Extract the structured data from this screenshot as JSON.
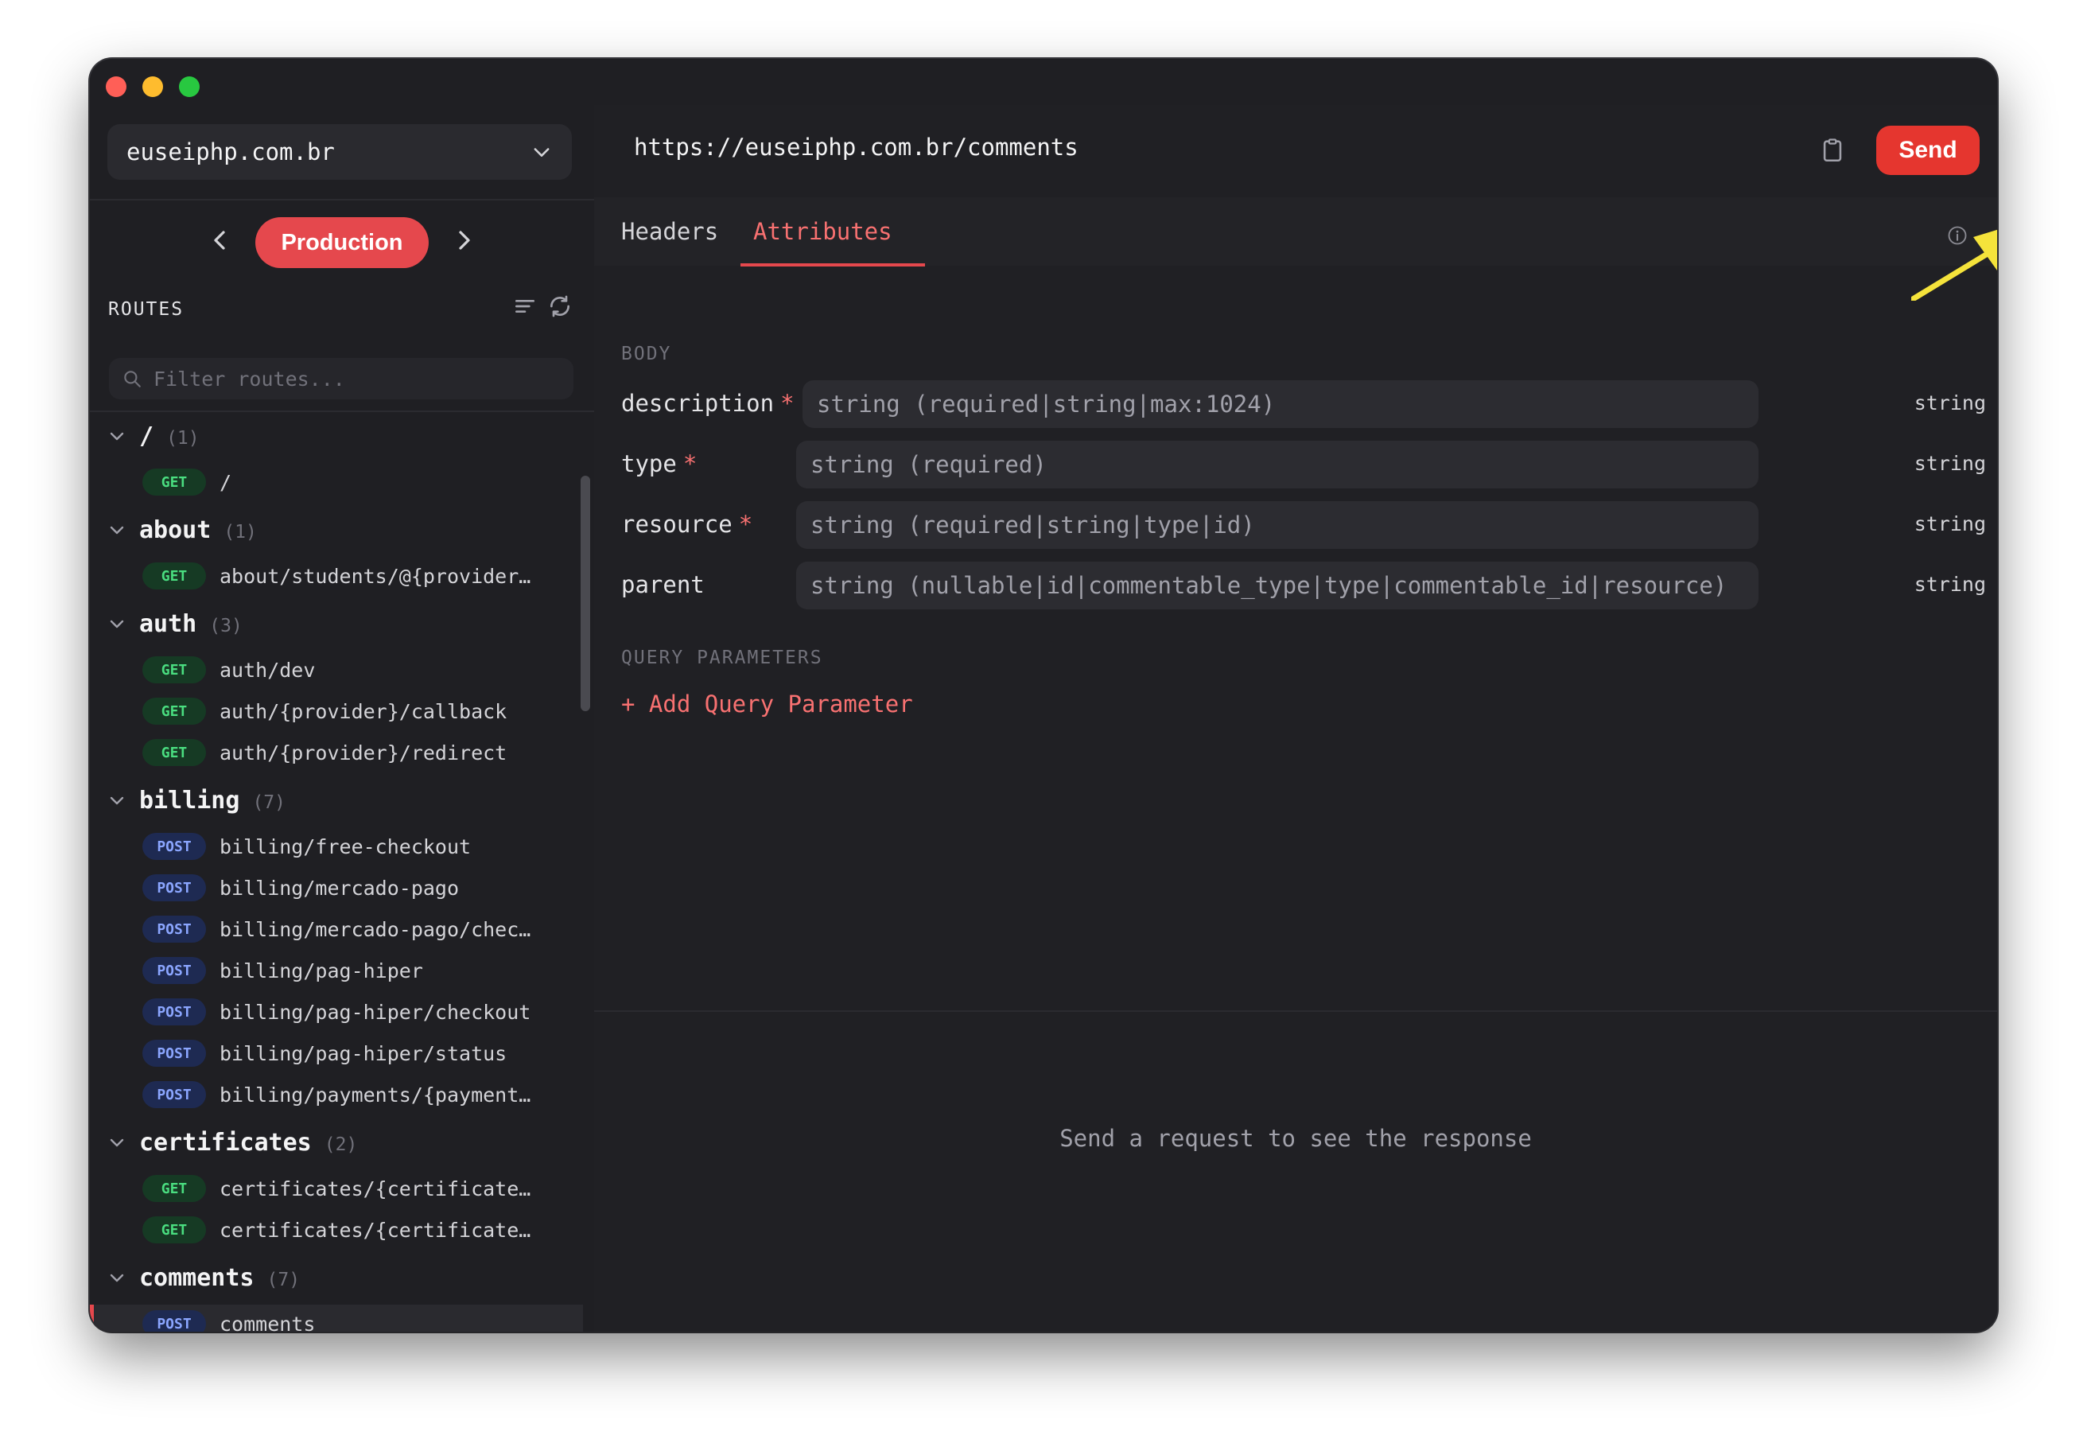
{
  "window": {
    "traffic_lights": [
      "close",
      "minimize",
      "zoom"
    ]
  },
  "sidebar": {
    "domain": "euseiphp.com.br",
    "environment": "Production",
    "routes_title": "ROUTES",
    "filter_placeholder": "Filter routes...",
    "groups": [
      {
        "name": "/",
        "count": "(1)",
        "routes": [
          {
            "method": "GET",
            "path": "/"
          }
        ]
      },
      {
        "name": "about",
        "count": "(1)",
        "routes": [
          {
            "method": "GET",
            "path": "about/students/@{provider…"
          }
        ]
      },
      {
        "name": "auth",
        "count": "(3)",
        "routes": [
          {
            "method": "GET",
            "path": "auth/dev"
          },
          {
            "method": "GET",
            "path": "auth/{provider}/callback"
          },
          {
            "method": "GET",
            "path": "auth/{provider}/redirect"
          }
        ]
      },
      {
        "name": "billing",
        "count": "(7)",
        "routes": [
          {
            "method": "POST",
            "path": "billing/free-checkout"
          },
          {
            "method": "POST",
            "path": "billing/mercado-pago"
          },
          {
            "method": "POST",
            "path": "billing/mercado-pago/chec…"
          },
          {
            "method": "POST",
            "path": "billing/pag-hiper"
          },
          {
            "method": "POST",
            "path": "billing/pag-hiper/checkout"
          },
          {
            "method": "POST",
            "path": "billing/pag-hiper/status"
          },
          {
            "method": "POST",
            "path": "billing/payments/{payment…"
          }
        ]
      },
      {
        "name": "certificates",
        "count": "(2)",
        "routes": [
          {
            "method": "GET",
            "path": "certificates/{certificate…"
          },
          {
            "method": "GET",
            "path": "certificates/{certificate…"
          }
        ]
      },
      {
        "name": "comments",
        "count": "(7)",
        "routes": [
          {
            "method": "POST",
            "path": "comments"
          }
        ]
      }
    ]
  },
  "request": {
    "url": "https://euseiphp.com.br/comments",
    "send_label": "Send",
    "tabs": {
      "headers": "Headers",
      "attributes": "Attributes"
    },
    "body_label": "BODY",
    "fields": [
      {
        "name": "description",
        "required": "*",
        "placeholder": "string (required|string|max:1024)",
        "type": "string"
      },
      {
        "name": "type",
        "required": "*",
        "placeholder": "string (required)",
        "type": "string"
      },
      {
        "name": "resource",
        "required": "*",
        "placeholder": "string (required|string|type|id)",
        "type": "string"
      },
      {
        "name": "parent",
        "required": "",
        "placeholder": "string (nullable|id|commentable_type|type|commentable_id|resource)",
        "type": "string"
      }
    ],
    "query_label": "QUERY PARAMETERS",
    "add_query": "+ Add Query Parameter"
  },
  "response": {
    "empty_message": "Send a request to see the response"
  },
  "colors": {
    "accent": "#e5484d",
    "send": "#e5362f",
    "get_badge": "#4ade80",
    "post_badge": "#8ba6ff",
    "annotation_arrow": "#f5e33b"
  },
  "icons": [
    "chevron-down-icon",
    "chevron-left-icon",
    "chevron-right-icon",
    "sort-icon",
    "refresh-icon",
    "search-icon",
    "clipboard-icon",
    "terminal-icon",
    "info-icon",
    "annotation-arrow-icon"
  ]
}
